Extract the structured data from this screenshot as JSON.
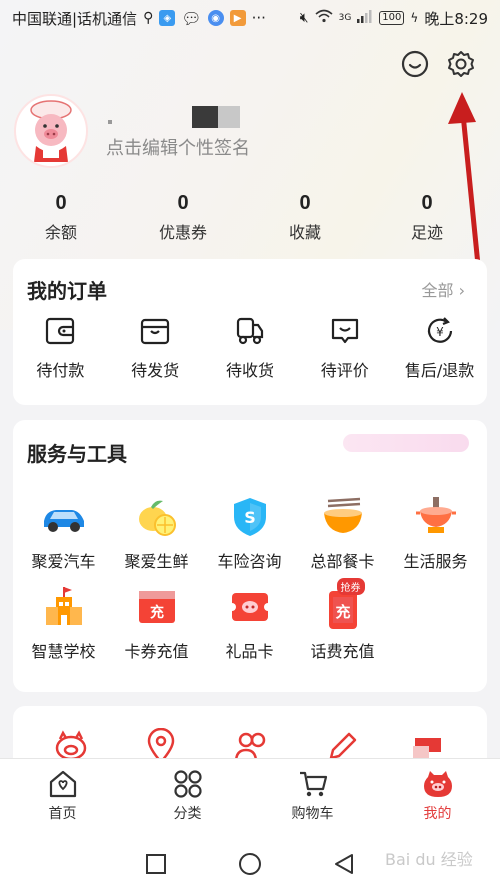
{
  "status_bar": {
    "carrier": "中国联通|话机通信",
    "battery": "100",
    "time": "晚上8:29",
    "network": "3G"
  },
  "header": {
    "chat_icon": "chat-smile-icon",
    "settings_icon": "gear-icon"
  },
  "profile": {
    "signature": "点击编辑个性签名"
  },
  "stats": [
    {
      "value": "0",
      "label": "余额"
    },
    {
      "value": "0",
      "label": "优惠券"
    },
    {
      "value": "0",
      "label": "收藏"
    },
    {
      "value": "0",
      "label": "足迹"
    }
  ],
  "orders": {
    "title": "我的订单",
    "all": "全部",
    "items": [
      {
        "label": "待付款",
        "icon": "wallet-icon"
      },
      {
        "label": "待发货",
        "icon": "package-icon"
      },
      {
        "label": "待收货",
        "icon": "truck-icon"
      },
      {
        "label": "待评价",
        "icon": "comment-icon"
      },
      {
        "label": "售后/退款",
        "icon": "refund-icon"
      }
    ]
  },
  "services": {
    "title": "服务与工具",
    "items": [
      {
        "label": "聚爱汽车",
        "icon": "car-icon"
      },
      {
        "label": "聚爱生鲜",
        "icon": "lemon-icon"
      },
      {
        "label": "车险咨询",
        "icon": "shield-icon"
      },
      {
        "label": "总部餐卡",
        "icon": "noodle-bowl-icon"
      },
      {
        "label": "生活服务",
        "icon": "hotpot-icon"
      },
      {
        "label": "智慧学校",
        "icon": "school-icon"
      },
      {
        "label": "卡券充值",
        "icon": "coupon-recharge-icon"
      },
      {
        "label": "礼品卡",
        "icon": "gift-card-icon"
      },
      {
        "label": "话费充值",
        "icon": "phone-recharge-icon",
        "badge": "抢券",
        "icon_text": "充"
      }
    ],
    "recharge_char": "充"
  },
  "tabs": [
    {
      "label": "首页",
      "icon": "home-icon"
    },
    {
      "label": "分类",
      "icon": "category-icon"
    },
    {
      "label": "购物车",
      "icon": "cart-icon"
    },
    {
      "label": "我的",
      "icon": "piggy-profile-icon",
      "active": true
    }
  ],
  "colors": {
    "accent": "#e23b3b",
    "text": "#222222",
    "muted": "#999999"
  },
  "watermark": "Bai du 经验"
}
